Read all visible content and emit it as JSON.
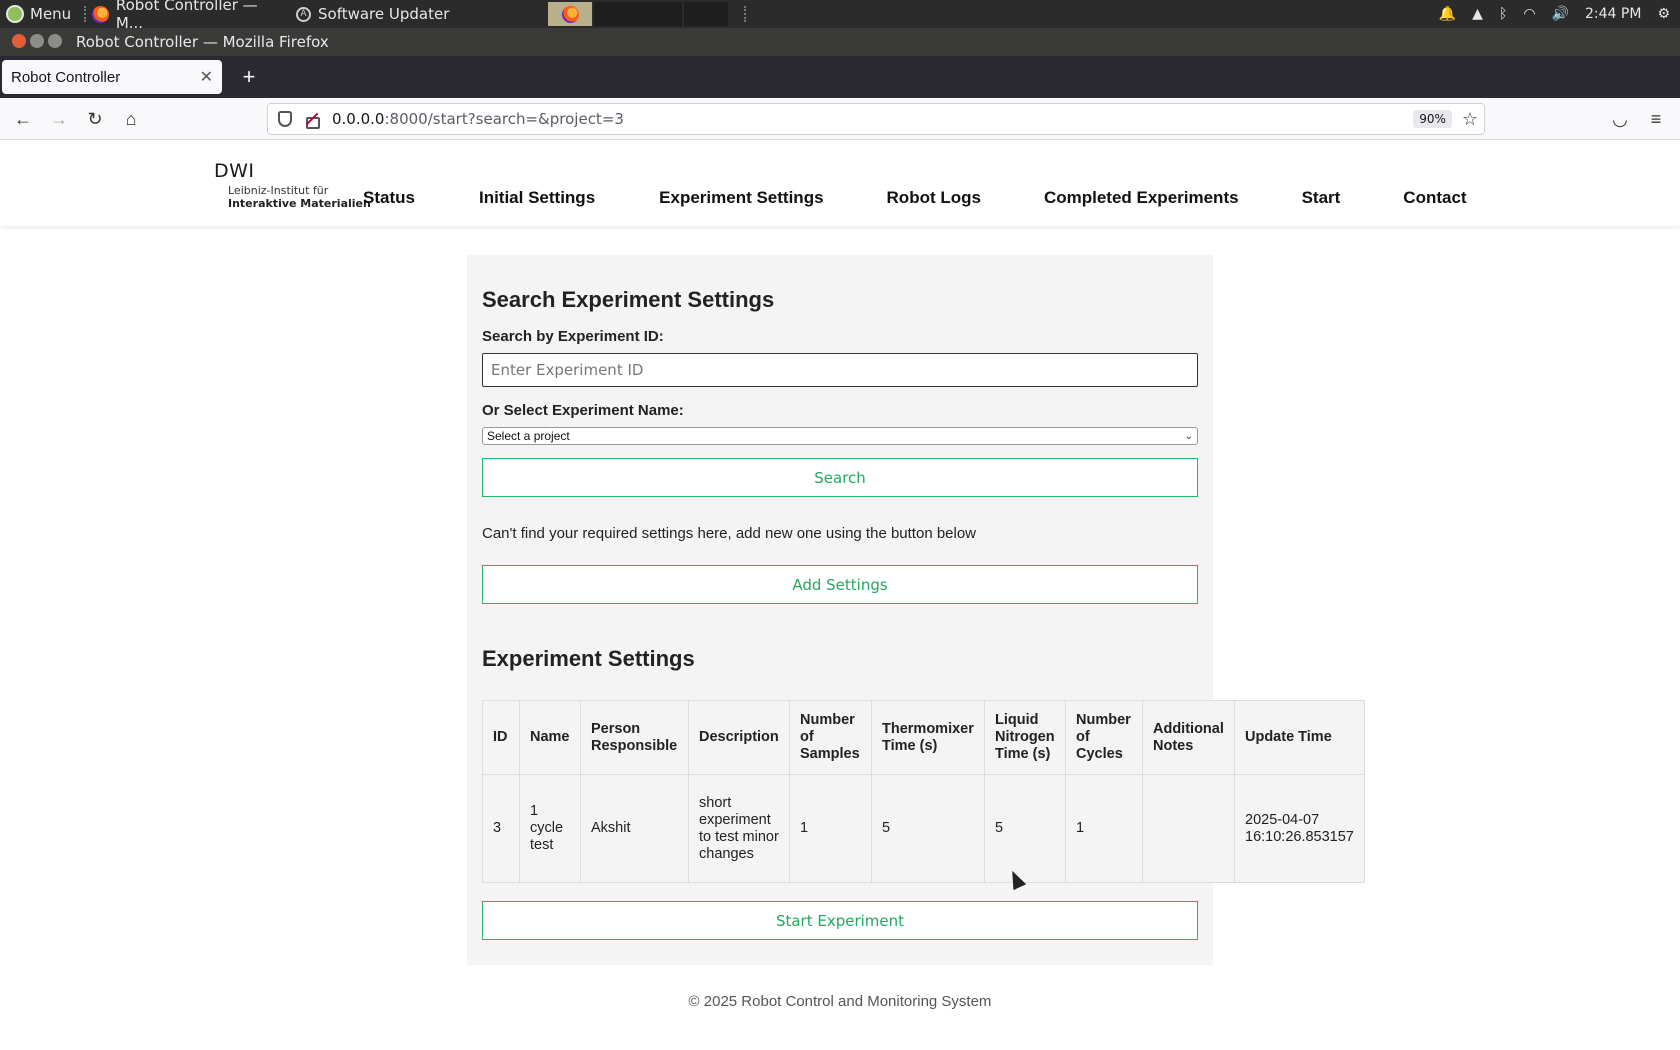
{
  "taskbar": {
    "menu_label": "Menu",
    "window1_label": "Robot Controller — M...",
    "window2_label": "Software Updater",
    "clock": "2:44 PM"
  },
  "browser": {
    "window_title": "Robot Controller — Mozilla Firefox",
    "tab_title": "Robot Controller",
    "url_host": "0.0.0.0",
    "url_rest": ":8000/start?search=&project=3",
    "zoom": "90%"
  },
  "site": {
    "logo_big": "DWI",
    "logo_line2": "Leibniz-Institut für",
    "logo_line3": "Interaktive Materialien",
    "nav": [
      "Status",
      "Initial Settings",
      "Experiment Settings",
      "Robot Logs",
      "Completed Experiments",
      "Start",
      "Contact"
    ]
  },
  "search": {
    "heading": "Search Experiment Settings",
    "id_label": "Search by Experiment ID:",
    "id_placeholder": "Enter Experiment ID",
    "name_label": "Or Select Experiment Name:",
    "select_value": "Select a project",
    "search_button": "Search",
    "hint": "Can't find your required settings here, add new one using the button below",
    "add_button": "Add Settings"
  },
  "settings": {
    "heading": "Experiment Settings",
    "columns": [
      "ID",
      "Name",
      "Person Responsible",
      "Description",
      "Number of Samples",
      "Thermomixer Time (s)",
      "Liquid Nitrogen Time (s)",
      "Number of Cycles",
      "Additional Notes",
      "Update Time"
    ],
    "rows": [
      [
        "3",
        "1 cycle test",
        "Akshit",
        "short experiment to test minor changes",
        "1",
        "5",
        "5",
        "1",
        "",
        "2025-04-07 16:10:26.853157"
      ]
    ],
    "start_button": "Start Experiment"
  },
  "footer": "© 2025 Robot Control and Monitoring System"
}
